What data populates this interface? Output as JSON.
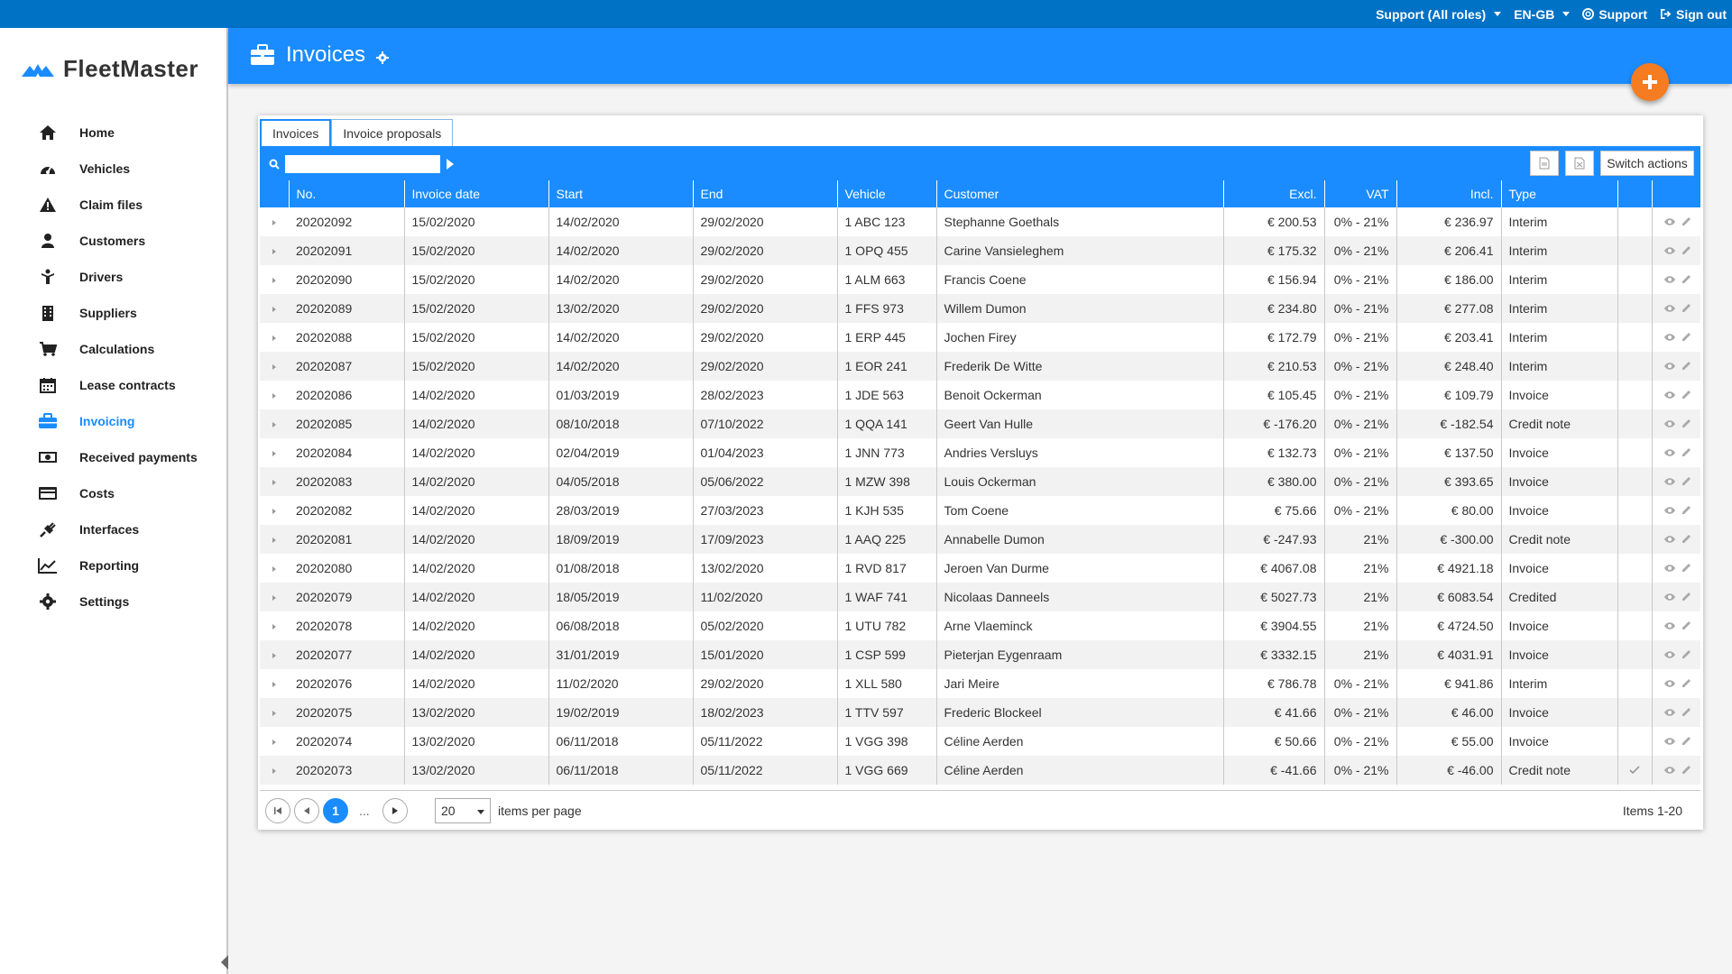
{
  "topbar": {
    "role": "Support (All roles)",
    "language": "EN-GB",
    "support": "Support",
    "signout": "Sign out"
  },
  "brand": {
    "name": "FleetMaster"
  },
  "nav": [
    {
      "label": "Home",
      "icon": "home-icon"
    },
    {
      "label": "Vehicles",
      "icon": "dashboard-icon"
    },
    {
      "label": "Claim files",
      "icon": "warning-icon"
    },
    {
      "label": "Customers",
      "icon": "user-icon"
    },
    {
      "label": "Drivers",
      "icon": "driver-icon"
    },
    {
      "label": "Suppliers",
      "icon": "building-icon"
    },
    {
      "label": "Calculations",
      "icon": "cart-icon"
    },
    {
      "label": "Lease contracts",
      "icon": "calendar-icon"
    },
    {
      "label": "Invoicing",
      "icon": "briefcase-icon"
    },
    {
      "label": "Received payments",
      "icon": "money-icon"
    },
    {
      "label": "Costs",
      "icon": "credit-card-icon"
    },
    {
      "label": "Interfaces",
      "icon": "plug-icon"
    },
    {
      "label": "Reporting",
      "icon": "line-chart-icon"
    },
    {
      "label": "Settings",
      "icon": "gear-icon"
    }
  ],
  "active_nav": "Invoicing",
  "header": {
    "title": "Invoices"
  },
  "tabs": [
    "Invoices",
    "Invoice proposals"
  ],
  "toolbar": {
    "search_value": "",
    "switch_actions": "Switch actions"
  },
  "columns": [
    "No.",
    "Invoice date",
    "Start",
    "End",
    "Vehicle",
    "Customer",
    "Excl.",
    "VAT",
    "Incl.",
    "Type"
  ],
  "rows": [
    [
      "20202092",
      "15/02/2020",
      "14/02/2020",
      "29/02/2020",
      "1 ABC 123",
      "Stephanne Goethals",
      "€ 200.53",
      "0% - 21%",
      "€ 236.97",
      "Interim",
      ""
    ],
    [
      "20202091",
      "15/02/2020",
      "14/02/2020",
      "29/02/2020",
      "1 OPQ 455",
      "Carine Vansieleghem",
      "€ 175.32",
      "0% - 21%",
      "€ 206.41",
      "Interim",
      ""
    ],
    [
      "20202090",
      "15/02/2020",
      "14/02/2020",
      "29/02/2020",
      "1 ALM 663",
      "Francis Coene",
      "€ 156.94",
      "0% - 21%",
      "€ 186.00",
      "Interim",
      ""
    ],
    [
      "20202089",
      "15/02/2020",
      "13/02/2020",
      "29/02/2020",
      "1 FFS 973",
      "Willem Dumon",
      "€ 234.80",
      "0% - 21%",
      "€ 277.08",
      "Interim",
      ""
    ],
    [
      "20202088",
      "15/02/2020",
      "14/02/2020",
      "29/02/2020",
      "1 ERP 445",
      "Jochen Firey",
      "€ 172.79",
      "0% - 21%",
      "€ 203.41",
      "Interim",
      ""
    ],
    [
      "20202087",
      "15/02/2020",
      "14/02/2020",
      "29/02/2020",
      "1 EOR 241",
      "Frederik De Witte",
      "€ 210.53",
      "0% - 21%",
      "€ 248.40",
      "Interim",
      ""
    ],
    [
      "20202086",
      "14/02/2020",
      "01/03/2019",
      "28/02/2023",
      "1 JDE 563",
      "Benoit Ockerman",
      "€ 105.45",
      "0% - 21%",
      "€ 109.79",
      "Invoice",
      ""
    ],
    [
      "20202085",
      "14/02/2020",
      "08/10/2018",
      "07/10/2022",
      "1 QQA 141",
      "Geert Van Hulle",
      "€ -176.20",
      "0% - 21%",
      "€ -182.54",
      "Credit note",
      ""
    ],
    [
      "20202084",
      "14/02/2020",
      "02/04/2019",
      "01/04/2023",
      "1 JNN 773",
      "Andries Versluys",
      "€ 132.73",
      "0% - 21%",
      "€ 137.50",
      "Invoice",
      ""
    ],
    [
      "20202083",
      "14/02/2020",
      "04/05/2018",
      "05/06/2022",
      "1 MZW 398",
      "Louis Ockerman",
      "€ 380.00",
      "0% - 21%",
      "€ 393.65",
      "Invoice",
      ""
    ],
    [
      "20202082",
      "14/02/2020",
      "28/03/2019",
      "27/03/2023",
      "1 KJH 535",
      "Tom Coene",
      "€ 75.66",
      "0% - 21%",
      "€ 80.00",
      "Invoice",
      ""
    ],
    [
      "20202081",
      "14/02/2020",
      "18/09/2019",
      "17/09/2023",
      "1 AAQ 225",
      "Annabelle Dumon",
      "€ -247.93",
      "21%",
      "€ -300.00",
      "Credit note",
      ""
    ],
    [
      "20202080",
      "14/02/2020",
      "01/08/2018",
      "13/02/2020",
      "1 RVD 817",
      "Jeroen Van Durme",
      "€ 4067.08",
      "21%",
      "€ 4921.18",
      "Invoice",
      ""
    ],
    [
      "20202079",
      "14/02/2020",
      "18/05/2019",
      "11/02/2020",
      "1 WAF 741",
      "Nicolaas Danneels",
      "€ 5027.73",
      "21%",
      "€ 6083.54",
      "Credited",
      ""
    ],
    [
      "20202078",
      "14/02/2020",
      "06/08/2018",
      "05/02/2020",
      "1 UTU 782",
      "Arne Vlaeminck",
      "€ 3904.55",
      "21%",
      "€ 4724.50",
      "Invoice",
      ""
    ],
    [
      "20202077",
      "14/02/2020",
      "31/01/2019",
      "15/01/2020",
      "1 CSP 599",
      "Pieterjan Eygenraam",
      "€ 3332.15",
      "21%",
      "€ 4031.91",
      "Invoice",
      ""
    ],
    [
      "20202076",
      "14/02/2020",
      "11/02/2020",
      "29/02/2020",
      "1 XLL 580",
      "Jari Meire",
      "€ 786.78",
      "0% - 21%",
      "€ 941.86",
      "Interim",
      ""
    ],
    [
      "20202075",
      "13/02/2020",
      "19/02/2019",
      "18/02/2023",
      "1 TTV 597",
      "Frederic Blockeel",
      "€ 41.66",
      "0% - 21%",
      "€ 46.00",
      "Invoice",
      ""
    ],
    [
      "20202074",
      "13/02/2020",
      "06/11/2018",
      "05/11/2022",
      "1 VGG 398",
      "Céline Aerden",
      "€ 50.66",
      "0% - 21%",
      "€ 55.00",
      "Invoice",
      ""
    ],
    [
      "20202073",
      "13/02/2020",
      "06/11/2018",
      "05/11/2022",
      "1 VGG 669",
      "Céline Aerden",
      "€ -41.66",
      "0% - 21%",
      "€ -46.00",
      "Credit note",
      "check"
    ]
  ],
  "pager": {
    "current_page": "1",
    "ellipsis": "...",
    "page_size": "20",
    "per_page_label": "items per page",
    "items_label": "Items 1-20"
  },
  "colors": {
    "topbar": "#0072c6",
    "header": "#1a8cff",
    "accent": "#1a8cff",
    "add_button": "#f57c20"
  }
}
